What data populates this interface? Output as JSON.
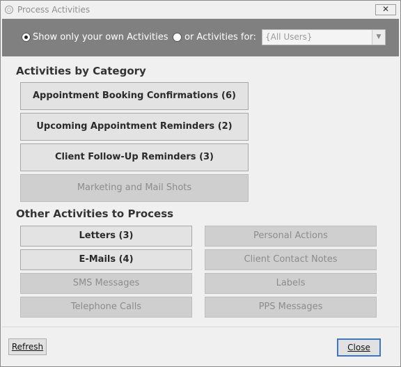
{
  "window": {
    "title": "Process Activities",
    "close_glyph": "✕",
    "icon": "app-circle-icon"
  },
  "filter": {
    "own_label": "Show only your own Activities",
    "own_selected": true,
    "for_label": "or Activities for:",
    "for_selected": false,
    "user_select": {
      "value": "{All Users}",
      "disabled": true,
      "arrow": "▼"
    }
  },
  "categories": {
    "title": "Activities by Category",
    "buttons": [
      {
        "label": "Appointment Booking Confirmations (6)",
        "enabled": true
      },
      {
        "label": "Upcoming Appointment Reminders (2)",
        "enabled": true
      },
      {
        "label": "Client Follow-Up Reminders (3)",
        "enabled": true
      },
      {
        "label": "Marketing and Mail Shots",
        "enabled": false
      }
    ]
  },
  "other": {
    "title": "Other Activities to Process",
    "left": [
      {
        "label": "Letters (3)",
        "enabled": true
      },
      {
        "label": "E-Mails (4)",
        "enabled": true
      },
      {
        "label": "SMS Messages",
        "enabled": false
      },
      {
        "label": "Telephone Calls",
        "enabled": false
      }
    ],
    "right": [
      {
        "label": "Personal Actions",
        "enabled": false
      },
      {
        "label": "Client Contact Notes",
        "enabled": false
      },
      {
        "label": "Labels",
        "enabled": false
      },
      {
        "label": "PPS Messages",
        "enabled": false
      }
    ]
  },
  "footer": {
    "refresh_label": "Refresh",
    "close_label": "Close"
  },
  "colors": {
    "filter_bar": "#808080",
    "enabled_button": "#e3e3e3",
    "disabled_button": "#cfcfcf",
    "default_button_border": "#3d76c4"
  }
}
